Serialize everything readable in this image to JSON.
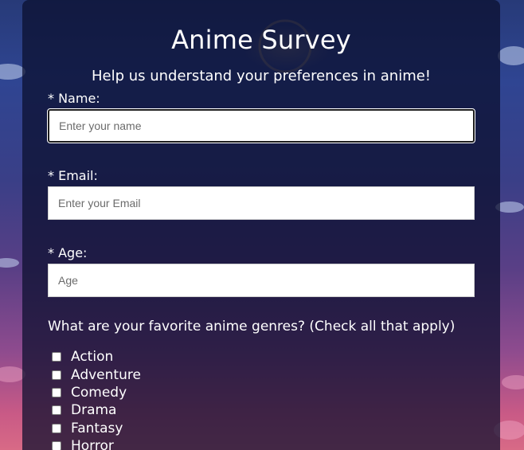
{
  "survey": {
    "title": "Anime Survey",
    "subtitle": "Help us understand your preferences in anime!",
    "fields": {
      "name": {
        "label": "* Name:",
        "placeholder": "Enter your name",
        "value": ""
      },
      "email": {
        "label": "* Email:",
        "placeholder": "Enter your Email",
        "value": ""
      },
      "age": {
        "label": "* Age:",
        "placeholder": "Age",
        "value": ""
      }
    },
    "genres_question": "What are your favorite anime genres? (Check all that apply)",
    "genres": [
      {
        "label": "Action",
        "checked": false
      },
      {
        "label": "Adventure",
        "checked": false
      },
      {
        "label": "Comedy",
        "checked": false
      },
      {
        "label": "Drama",
        "checked": false
      },
      {
        "label": "Fantasy",
        "checked": false
      },
      {
        "label": "Horror",
        "checked": false
      }
    ]
  },
  "colors": {
    "card_background": "#0a0e2d",
    "text": "#ffffff",
    "input_background": "#ffffff",
    "focus_border": "#1d1d1d"
  }
}
